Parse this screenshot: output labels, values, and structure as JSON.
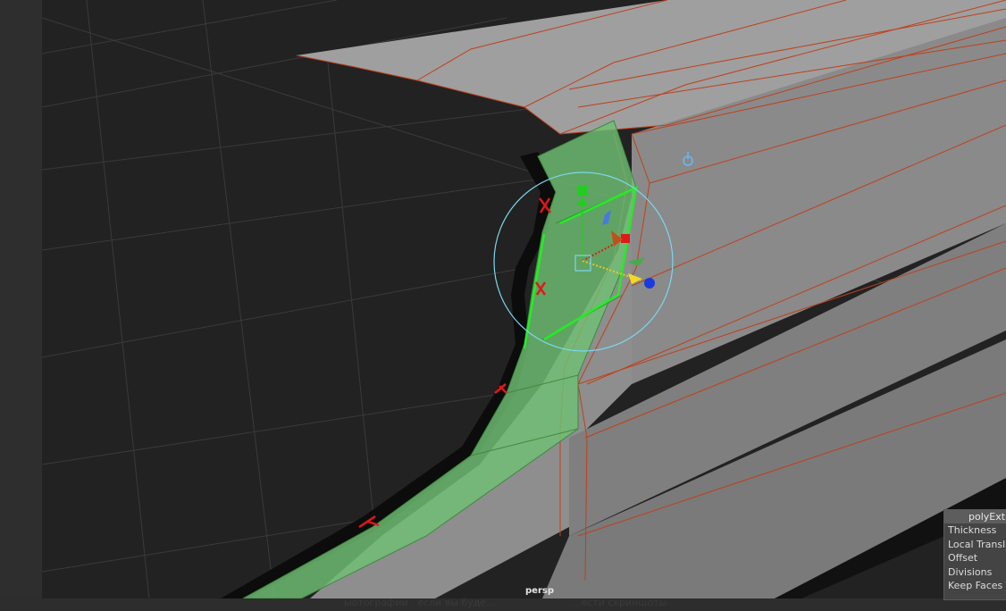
{
  "viewport": {
    "camera": "persp"
  },
  "channel_box": {
    "node_name": "polyExtr",
    "attributes": [
      "Thickness",
      "Local Transla",
      "Offset",
      "Divisions",
      "Keep Faces T"
    ]
  },
  "status_bar": {
    "left_text": "ыотографии · если вы буде...",
    "right_text": "...ести скриншоты"
  },
  "colors": {
    "viewport_bg": "#222222",
    "mesh_light": "#9e9e9e",
    "mesh_mid": "#8a8a8a",
    "mesh_edge": "#c0401a",
    "selected_face": "#6fbf73",
    "selected_edge": "#22ee22",
    "manip_ring": "#7ad8ee",
    "axis_x": "#e01818",
    "axis_y": "#22cc22",
    "axis_z": "#1a3ae0"
  },
  "icons": [
    "pivot-icon",
    "move-manipulator-icon",
    "rotate-ring-icon",
    "scale-handle-icon"
  ]
}
